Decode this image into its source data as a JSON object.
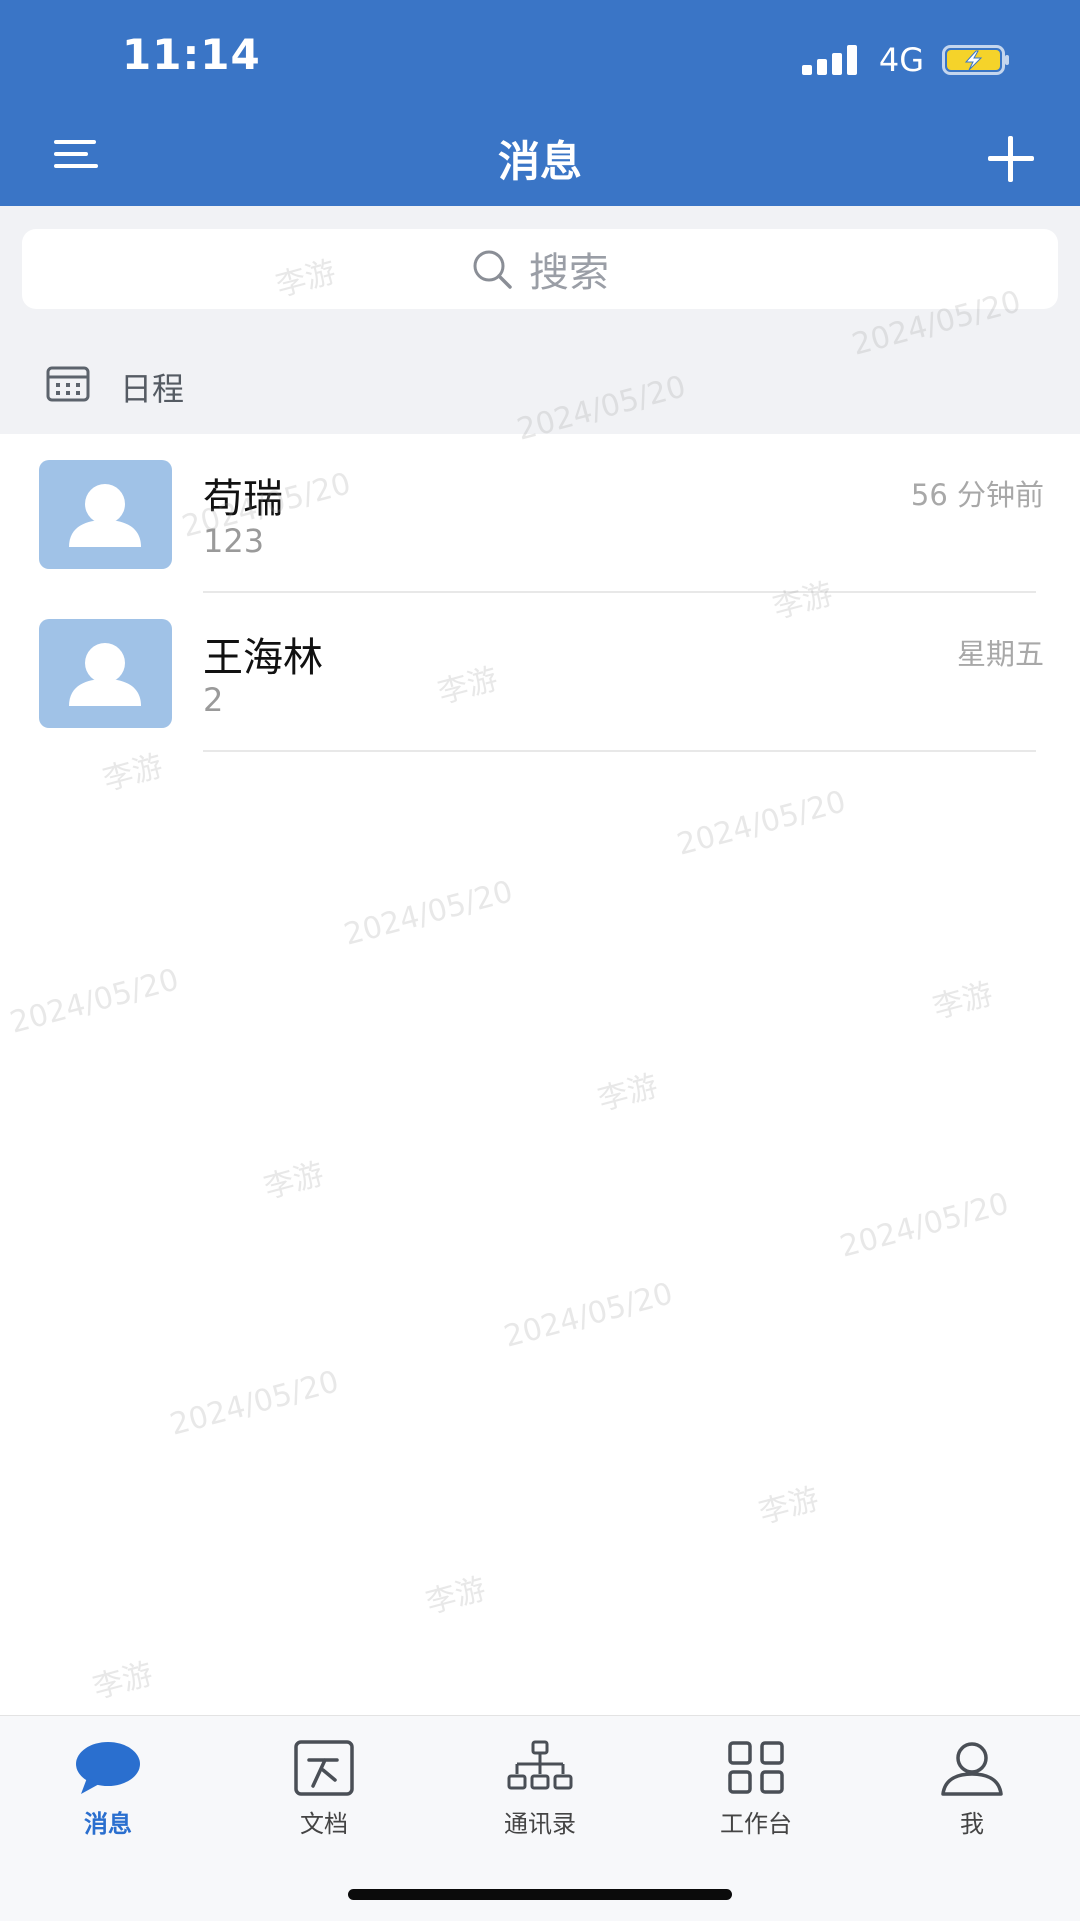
{
  "status_bar": {
    "time": "11:14",
    "network": "4G"
  },
  "header": {
    "title": "消息"
  },
  "search": {
    "placeholder": "搜索"
  },
  "schedule": {
    "label": "日程"
  },
  "chats": [
    {
      "name": "苟瑞",
      "preview": "123",
      "time": "56 分钟前"
    },
    {
      "name": "王海林",
      "preview": "2",
      "time": "星期五"
    }
  ],
  "watermark": {
    "name": "李游",
    "date": "2024/05/20"
  },
  "tabs": [
    {
      "label": "消息",
      "icon": "chat-bubble-icon",
      "active": true
    },
    {
      "label": "文档",
      "icon": "document-icon",
      "active": false
    },
    {
      "label": "通讯录",
      "icon": "org-chart-icon",
      "active": false
    },
    {
      "label": "工作台",
      "icon": "grid-icon",
      "active": false
    },
    {
      "label": "我",
      "icon": "person-icon",
      "active": false
    }
  ],
  "colors": {
    "brand": "#3a75c6",
    "active_tab": "#2a6fcf",
    "avatar_bg": "#a0c2e7",
    "battery_fill": "#f5d32a"
  }
}
